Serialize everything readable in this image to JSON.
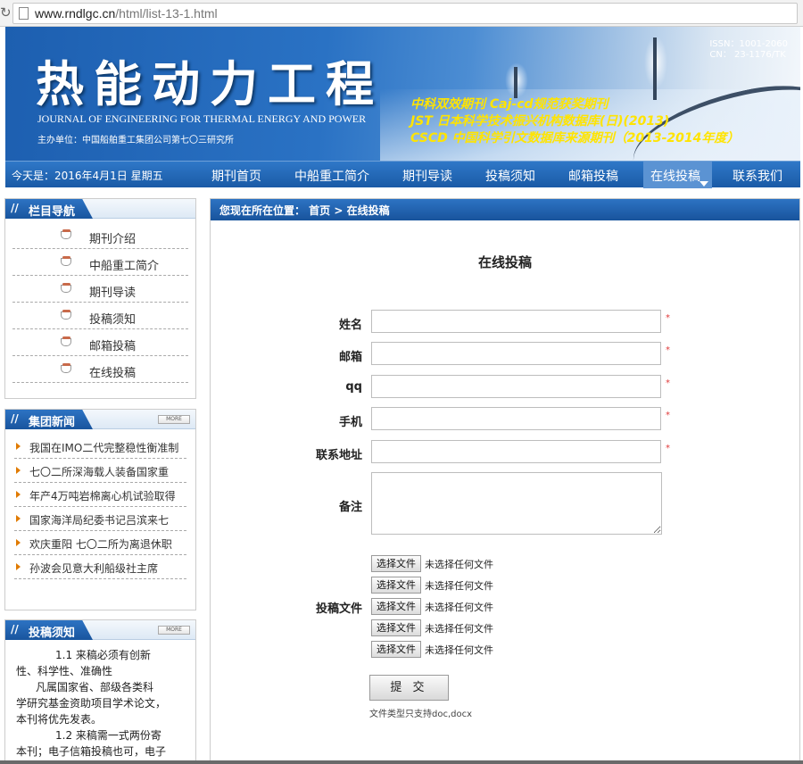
{
  "browser": {
    "url_domain": "www.rndlgc.cn",
    "url_path": "/html/list-13-1.html"
  },
  "banner": {
    "title": "热能动力工程",
    "subtitle": "JOURNAL OF ENGINEERING FOR THERMAL ENERGY AND POWER",
    "sponsor": "主办单位：中国船舶重工集团公司第七〇三研究所",
    "issn": "ISSN：1001-2060",
    "cn": "CN： 23-1176/TK",
    "lines": [
      "中科双效期刊 Caj-cd规范获奖期刊",
      "JST 日本科学技术振兴机构数据库(日)(2013)",
      "CSCD 中国科学引文数据库来源期刊（2013-2014年度）"
    ]
  },
  "nav": {
    "today": "今天是：2016年4月1日 星期五",
    "items": [
      "期刊首页",
      "中船重工简介",
      "期刊导读",
      "投稿须知",
      "邮箱投稿",
      "在线投稿",
      "联系我们"
    ]
  },
  "sidebar": {
    "column_title": "栏目导航",
    "column_items": [
      "期刊介绍",
      "中船重工简介",
      "期刊导读",
      "投稿须知",
      "邮箱投稿",
      "在线投稿"
    ],
    "news_title": "集团新闻",
    "more_label": "MORE",
    "news_items": [
      "我国在IMO二代完整稳性衡准制",
      "七〇二所深海载人装备国家重",
      "年产4万吨岩棉离心机试验取得",
      "国家海洋局纪委书记吕滨来七",
      "欢庆重阳 七〇二所为离退休职",
      "孙波会见意大利船级社主席"
    ],
    "notice_title": "投稿须知",
    "notice_lines": [
      "1.1 来稿必须有创新",
      "性、科学性、准确性",
      "凡属国家省、部级各类科",
      "学研究基金资助项目学术论文，",
      "本刊将优先发表。",
      "1.2 来稿需一式两份寄",
      "本刊；电子信箱投稿也可，电子"
    ]
  },
  "main": {
    "breadcrumb": "您现在所在位置： 首页 > 在线投稿",
    "heading": "在线投稿",
    "form": {
      "name_label": "姓名",
      "email_label": "邮箱",
      "qq_label": "qq",
      "phone_label": "手机",
      "address_label": "联系地址",
      "note_label": "备注",
      "files_label": "投稿文件",
      "required_mark": "*",
      "file_button": "选择文件",
      "file_status": "未选择任何文件",
      "submit": "提 交",
      "hint": "文件类型只支持doc,docx"
    }
  },
  "colors": {
    "nav_blue": "#1a5aa6",
    "banner_yellow": "#ffe400",
    "required_red": "#e03a3a"
  }
}
